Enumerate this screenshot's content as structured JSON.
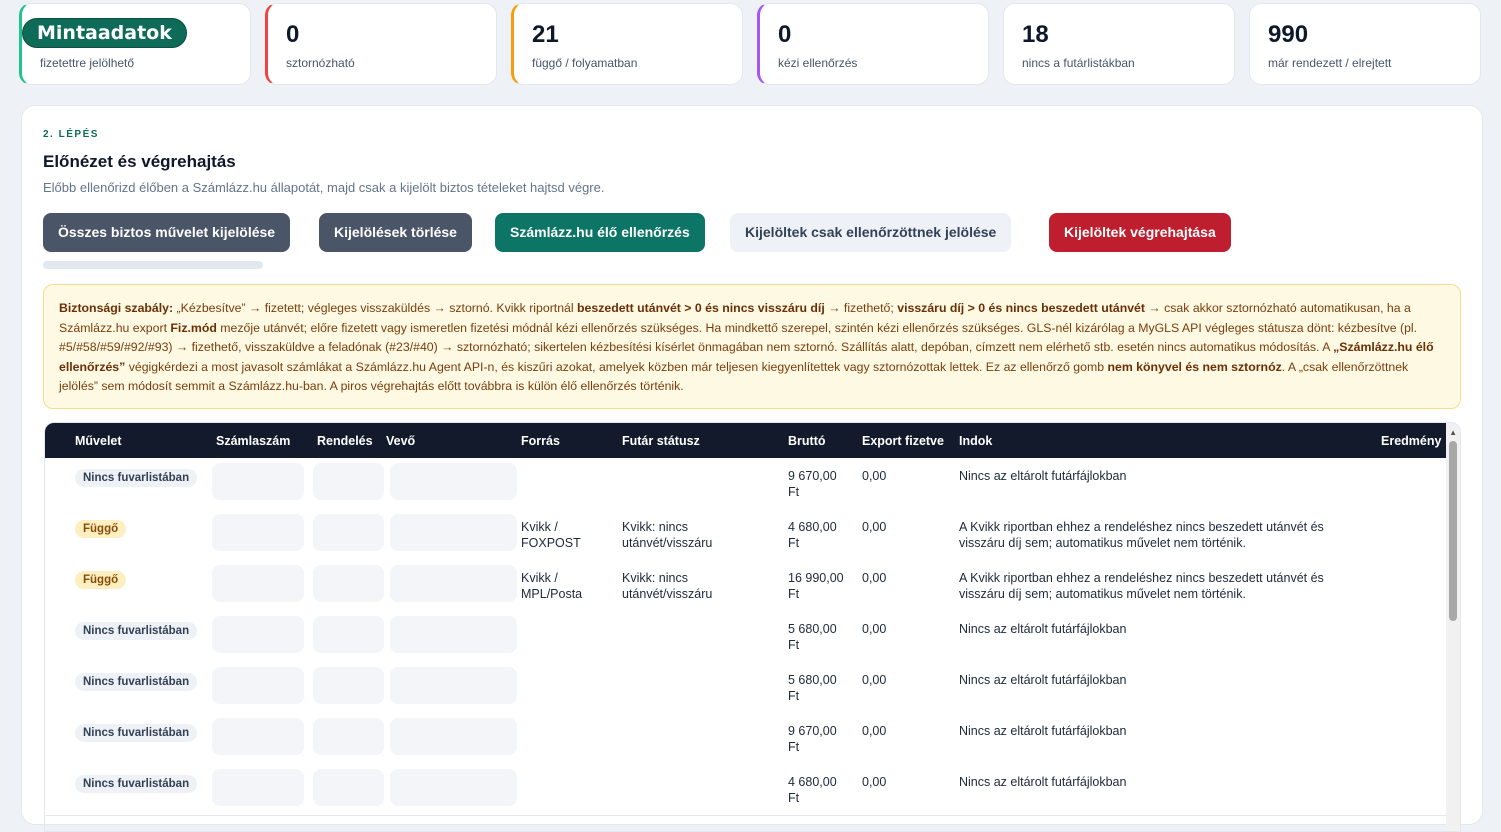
{
  "stats": [
    {
      "value": "Mintaadatok",
      "label": "fizetettre jelölhető",
      "color": "#22c38e"
    },
    {
      "value": "0",
      "label": "sztornózható",
      "color": "#ef4444"
    },
    {
      "value": "21",
      "label": "függő / folyamatban",
      "color": "#f59e0b"
    },
    {
      "value": "0",
      "label": "kézi ellenőrzés",
      "color": "#a855f7"
    },
    {
      "value": "18",
      "label": "nincs a futárlistákban",
      "color": "#e2e8f0"
    },
    {
      "value": "990",
      "label": "már rendezett / elrejtett",
      "color": "#e2e8f0"
    }
  ],
  "panel": {
    "step": "2. LÉPÉS",
    "title": "Előnézet és végrehajtás",
    "subtitle": "Előbb ellenőrizd élőben a Számlázz.hu állapotát, majd csak a kijelölt biztos tételeket hajtsd végre."
  },
  "buttons": {
    "select_all": "Összes biztos művelet kijelölése",
    "clear": "Kijelölések törlése",
    "live_check": "Számlázz.hu élő ellenőrzés",
    "mark_checked": "Kijelöltek csak ellenőrzöttnek jelölése",
    "execute": "Kijelöltek végrehajtása"
  },
  "notice": {
    "p1_label": "Biztonsági szabály:",
    "p2": " „Kézbesítve” → fizetett; végleges visszaküldés → sztornó. Kvikk riportnál ",
    "p3_bold": "beszedett utánvét > 0 és nincs visszáru díj",
    "p4": " → fizethető; ",
    "p5_bold": "visszáru díj > 0 és nincs beszedett utánvét",
    "p6": " → csak akkor sztornózható automatikusan, ha a Számlázz.hu export ",
    "p7_bold": "Fiz.mód",
    "p8": " mezője utánvét; előre fizetett vagy ismeretlen fizetési módnál kézi ellenőrzés szükséges. Ha mindkettő szerepel, szintén kézi ellenőrzés szükséges. GLS-nél kizárólag a MyGLS API végleges státusza dönt: kézbesítve (pl. #5/#58/#59/#92/#93) → fizethető, visszaküldve a feladónak (#23/#40) → sztornózható; sikertelen kézbesítési kísérlet önmagában nem sztornó. Szállítás alatt, depóban, címzett nem elérhető stb. esetén nincs automatikus módosítás. A ",
    "p9_bold": "„Számlázz.hu élő ellenőrzés”",
    "p10": " végigkérdezi a most javasolt számlákat a Számlázz.hu Agent API-n, és kiszűri azokat, amelyek közben már teljesen kiegyenlítettek vagy sztornózottak lettek. Ez az ellenőrző gomb ",
    "p11_bold": "nem könyvel és nem sztornóz",
    "p12": ". A „csak ellenőrzöttnek jelölés” sem módosít semmit a Számlázz.hu-ban. A piros végrehajtás előtt továbbra is külön élő ellenőrzés történik."
  },
  "table": {
    "headers": {
      "action": "Művelet",
      "invoice": "Számlaszám",
      "order": "Rendelés",
      "buyer": "Vevő",
      "source": "Forrás",
      "courier_status": "Futár státusz",
      "gross": "Bruttó",
      "export_paid": "Export fizetve",
      "reason": "Indok",
      "result": "Eredmény"
    },
    "rows": [
      {
        "status": "Nincs fuvarlistában",
        "type": "none",
        "source": "",
        "courier": "",
        "gross": "9 670,00 Ft",
        "paid": "0,00",
        "reason": "Nincs az eltárolt futárfájlokban"
      },
      {
        "status": "Függő",
        "type": "wait",
        "source": "Kvikk / FOXPOST",
        "courier": "Kvikk: nincs utánvét/visszáru",
        "gross": "4 680,00 Ft",
        "paid": "0,00",
        "reason": "A Kvikk riportban ehhez a rendeléshez nincs beszedett utánvét és visszáru díj sem; automatikus művelet nem történik."
      },
      {
        "status": "Függő",
        "type": "wait",
        "source": "Kvikk / MPL/Posta",
        "courier": "Kvikk: nincs utánvét/visszáru",
        "gross": "16 990,00 Ft",
        "paid": "0,00",
        "reason": "A Kvikk riportban ehhez a rendeléshez nincs beszedett utánvét és visszáru díj sem; automatikus művelet nem történik."
      },
      {
        "status": "Nincs fuvarlistában",
        "type": "none",
        "source": "",
        "courier": "",
        "gross": "5 680,00 Ft",
        "paid": "0,00",
        "reason": "Nincs az eltárolt futárfájlokban"
      },
      {
        "status": "Nincs fuvarlistában",
        "type": "none",
        "source": "",
        "courier": "",
        "gross": "5 680,00 Ft",
        "paid": "0,00",
        "reason": "Nincs az eltárolt futárfájlokban"
      },
      {
        "status": "Nincs fuvarlistában",
        "type": "none",
        "source": "",
        "courier": "",
        "gross": "9 670,00 Ft",
        "paid": "0,00",
        "reason": "Nincs az eltárolt futárfájlokban"
      },
      {
        "status": "Nincs fuvarlistában",
        "type": "none",
        "source": "",
        "courier": "",
        "gross": "4 680,00 Ft",
        "paid": "0,00",
        "reason": "Nincs az eltárolt futárfájlokban"
      }
    ]
  }
}
